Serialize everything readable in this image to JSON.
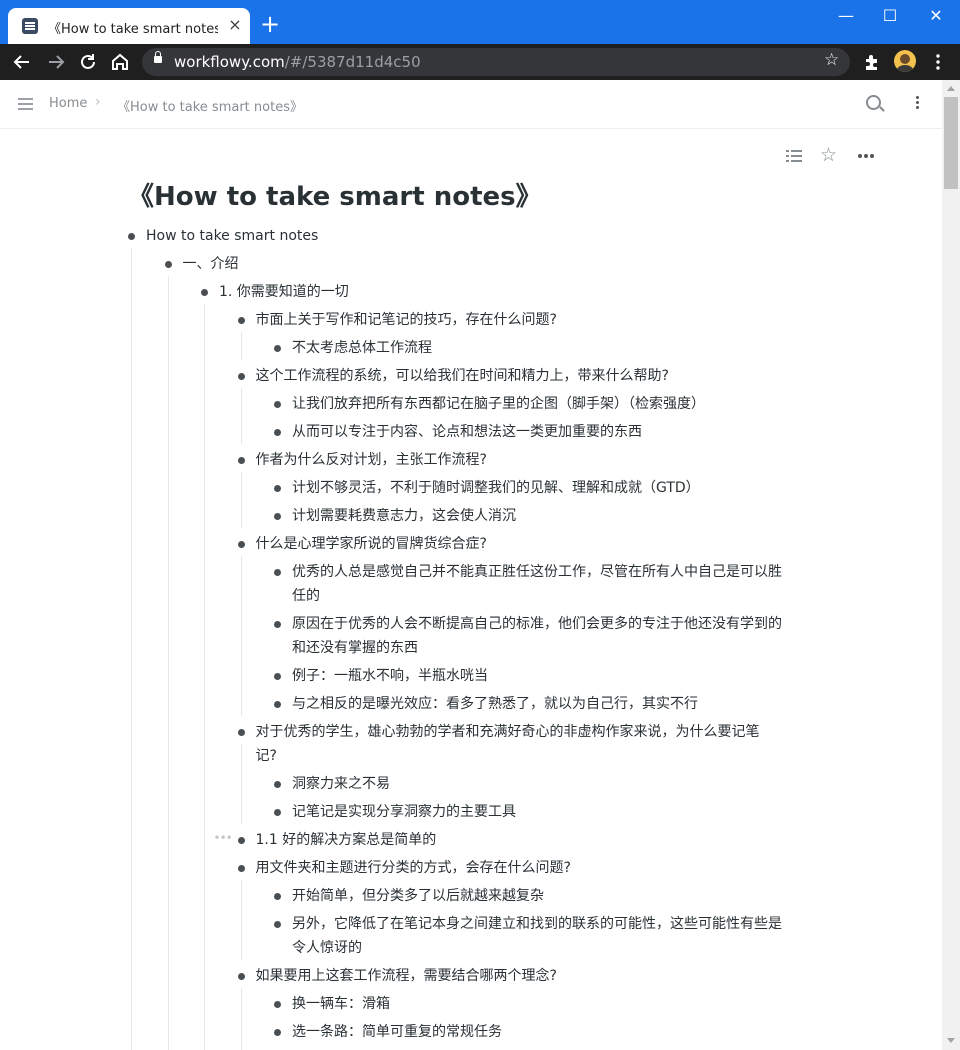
{
  "browser": {
    "tab_title": "《How to take smart notes》 - WorkFlowy",
    "tab_close_glyph": "×",
    "new_tab_glyph": "+",
    "window_controls": [
      "—",
      "☐",
      "✕"
    ],
    "url_host": "workflowy.com",
    "url_path": "/#/5387d11d4c50",
    "accent_color": "#1a73e8",
    "icons": [
      "back-arrow-icon",
      "forward-arrow-icon",
      "reload-icon",
      "home-icon",
      "lock-icon",
      "star-icon",
      "extensions-icon",
      "profile-avatar",
      "chrome-menu-icon"
    ]
  },
  "app": {
    "breadcrumb": [
      "Home",
      "《How to take smart notes》"
    ],
    "breadcrumb_separator": "›",
    "title": "《How to take smart notes》"
  },
  "outline": [
    {
      "text": "How to take smart notes",
      "depth": 0
    },
    {
      "text": "一、介绍",
      "depth": 1
    },
    {
      "text": "1. 你需要知道的一切",
      "depth": 2
    },
    {
      "text": "市面上关于写作和记笔记的技巧，存在什么问题?",
      "depth": 3
    },
    {
      "text": "不太考虑总体工作流程",
      "depth": 4
    },
    {
      "text": "这个工作流程的系统，可以给我们在时间和精力上，带来什么帮助?",
      "depth": 3
    },
    {
      "text": "让我们放弃把所有东西都记在脑子里的企图（脚手架）（检索强度）",
      "depth": 4
    },
    {
      "text": "从而可以专注于内容、论点和想法这一类更加重要的东西",
      "depth": 4
    },
    {
      "text": "作者为什么反对计划，主张工作流程?",
      "depth": 3
    },
    {
      "text": "计划不够灵活，不利于随时调整我们的见解、理解和成就（GTD）",
      "depth": 4
    },
    {
      "text": "计划需要耗费意志力，这会使人消沉",
      "depth": 4
    },
    {
      "text": "什么是心理学家所说的冒牌货综合症?",
      "depth": 3
    },
    {
      "text": "优秀的人总是感觉自己并不能真正胜任这份工作，尽管在所有人中自己是可以胜",
      "text2": "任的",
      "depth": 4
    },
    {
      "text": "原因在于优秀的人会不断提高自己的标准，他们会更多的专注于他还没有学到的",
      "text2": "和还没有掌握的东西",
      "depth": 4
    },
    {
      "text": "例子：一瓶水不响，半瓶水咣当",
      "depth": 4
    },
    {
      "text": "与之相反的是曝光效应：看多了熟悉了，就以为自己行，其实不行",
      "depth": 4
    },
    {
      "text": "对于优秀的学生，雄心勃勃的学者和充满好奇心的非虚构作家来说，为什么要记笔",
      "text2": "记?",
      "depth": 3
    },
    {
      "text": "洞察力来之不易",
      "depth": 4
    },
    {
      "text": "记笔记是实现分享洞察力的主要工具",
      "depth": 4
    },
    {
      "text": "1.1 好的解决方案总是简单的",
      "depth": 3,
      "has_handle": true
    },
    {
      "text": "用文件夹和主题进行分类的方式，会存在什么问题?",
      "depth": 3
    },
    {
      "text": "开始简单，但分类多了以后就越来越复杂",
      "depth": 4
    },
    {
      "text": "另外，它降低了在笔记本身之间建立和找到的联系的可能性，这些可能性有些是",
      "text2": "令人惊讶的",
      "depth": 4
    },
    {
      "text": "如果要用上这套工作流程，需要结合哪两个理念?",
      "depth": 3
    },
    {
      "text": "换一辆车：滑箱",
      "depth": 4
    },
    {
      "text": "选一条路：简单可重复的常规任务",
      "depth": 4
    }
  ]
}
